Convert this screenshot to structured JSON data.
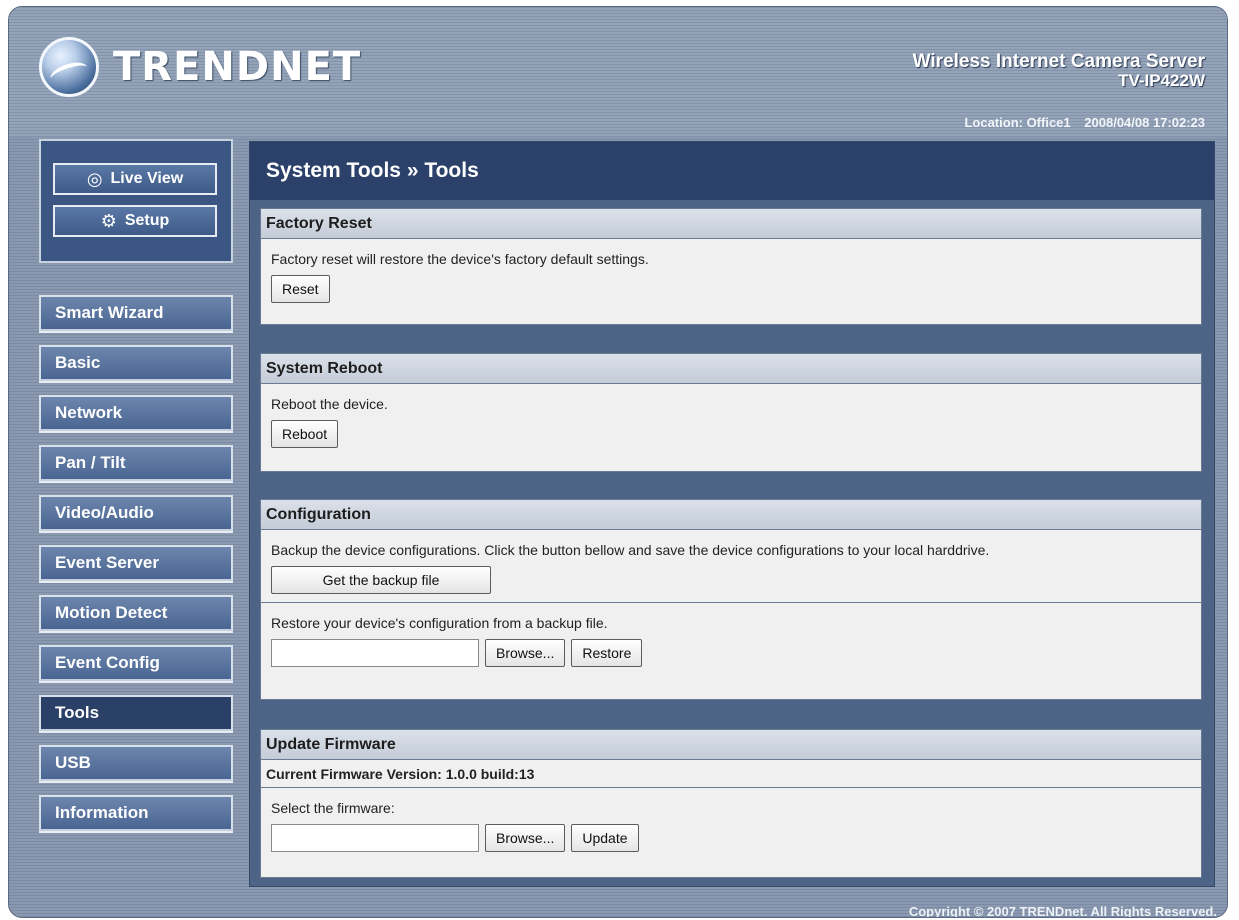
{
  "brand": {
    "name": "TRENDNET",
    "logo_icon": "trendnet-globe-logo"
  },
  "product": {
    "line1": "Wireless Internet Camera Server",
    "line2": "TV-IP422W"
  },
  "status": {
    "location": "Location: Office1",
    "datetime": "2008/04/08 17:02:23"
  },
  "view_buttons": {
    "live_view": "Live View",
    "setup": "Setup"
  },
  "nav": {
    "items": [
      {
        "label": "Smart Wizard"
      },
      {
        "label": "Basic"
      },
      {
        "label": "Network"
      },
      {
        "label": "Pan / Tilt"
      },
      {
        "label": "Video/Audio"
      },
      {
        "label": "Event Server"
      },
      {
        "label": "Motion Detect"
      },
      {
        "label": "Event Config"
      },
      {
        "label": "Tools",
        "active": true
      },
      {
        "label": "USB"
      },
      {
        "label": "Information"
      }
    ]
  },
  "page": {
    "title": "System Tools » Tools"
  },
  "factory_reset": {
    "title": "Factory Reset",
    "description": "Factory reset will restore the device's factory default settings.",
    "button": "Reset"
  },
  "system_reboot": {
    "title": "System Reboot",
    "description": "Reboot the device.",
    "button": "Reboot"
  },
  "configuration": {
    "title": "Configuration",
    "backup_text": "Backup the device configurations. Click the button bellow and save the device configurations to your local harddrive.",
    "backup_button": "Get the backup file",
    "restore_text": "Restore your device's configuration from a backup file.",
    "file_value": "",
    "browse_button": "Browse...",
    "restore_button": "Restore"
  },
  "update_firmware": {
    "title": "Update Firmware",
    "current_version": "Current Firmware Version: 1.0.0 build:13",
    "select_text": "Select the firmware:",
    "file_value": "",
    "browse_button": "Browse...",
    "update_button": "Update"
  },
  "footer": {
    "copyright": "Copyright © 2007 TRENDnet. All Rights Reserved."
  },
  "colors": {
    "header": "#8a99b0",
    "content_bg": "#4d6487",
    "title_bar": "#2b416a",
    "nav_active": "#2a4066"
  }
}
